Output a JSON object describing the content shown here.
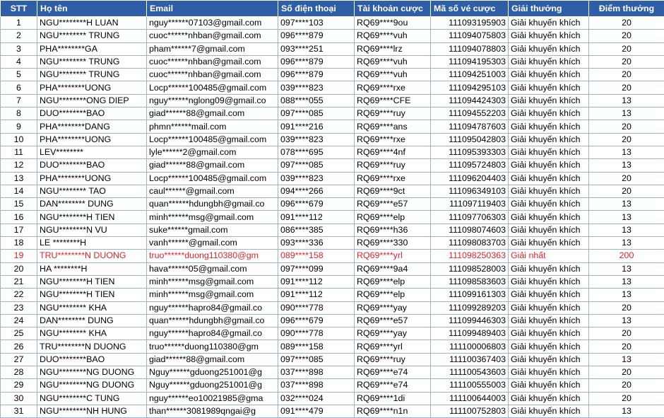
{
  "headers": {
    "stt": "STT",
    "ho_ten": "Họ tên",
    "email": "Email",
    "so_dien_thoai": "Số điện thoại",
    "tai_khoan_cuoc": "Tài khoản cược",
    "ma_so_ve_cuoc": "Mã số vé cược",
    "giai_thuong": "Giải thưởng",
    "diem_thuong": "Điểm thưởng"
  },
  "highlight_color": "#e8202a",
  "header_color": "#2f5ea8",
  "rows": [
    {
      "stt": "1",
      "ho_ten": "NGU********H LUAN",
      "email": "nguy******07103@gmail.com",
      "phone": "097****103",
      "account": "RQ69****9ou",
      "ticket": "111093195903",
      "prize": "Giải khuyến khích",
      "points": "20",
      "highlight": false
    },
    {
      "stt": "2",
      "ho_ten": "NGU******** TRUNG",
      "email": "cuoc******nhban@gmail.com",
      "phone": "096****879",
      "account": "RQ69****vuh",
      "ticket": "111094075803",
      "prize": "Giải khuyến khích",
      "points": "20",
      "highlight": false
    },
    {
      "stt": "3",
      "ho_ten": "PHA********GA",
      "email": "pham******7@gmail.com",
      "phone": "093****251",
      "account": "RQ69****lrz",
      "ticket": "111094078803",
      "prize": "Giải khuyến khích",
      "points": "20",
      "highlight": false
    },
    {
      "stt": "4",
      "ho_ten": "NGU******** TRUNG",
      "email": "cuoc******nhban@gmail.com",
      "phone": "096****879",
      "account": "RQ69****vuh",
      "ticket": "111094195303",
      "prize": "Giải khuyến khích",
      "points": "20",
      "highlight": false
    },
    {
      "stt": "5",
      "ho_ten": "NGU******** TRUNG",
      "email": "cuoc******nhban@gmail.com",
      "phone": "096****879",
      "account": "RQ69****vuh",
      "ticket": "111094251003",
      "prize": "Giải khuyến khích",
      "points": "20",
      "highlight": false
    },
    {
      "stt": "6",
      "ho_ten": "PHA********UONG",
      "email": "Locp******100485@gmail.com",
      "phone": "039****823",
      "account": "RQ69****rxe",
      "ticket": "111094295103",
      "prize": "Giải khuyến khích",
      "points": "20",
      "highlight": false
    },
    {
      "stt": "7",
      "ho_ten": "NGU********ONG DIEP",
      "email": "nguy******nglong09@gmail.co",
      "phone": "088****055",
      "account": "RQ69****CFE",
      "ticket": "111094424303",
      "prize": "Giải khuyến khích",
      "points": "13",
      "highlight": false
    },
    {
      "stt": "8",
      "ho_ten": "DUO********BAO",
      "email": "giad******88@gmail.com",
      "phone": "097****085",
      "account": "RQ69****ruy",
      "ticket": "111094552203",
      "prize": "Giải khuyến khích",
      "points": "13",
      "highlight": false
    },
    {
      "stt": "9",
      "ho_ten": "PHA********DANG",
      "email": "phmn******mail.com",
      "phone": "091****216",
      "account": "RQ69****ans",
      "ticket": "111094787603",
      "prize": "Giải khuyến khích",
      "points": "20",
      "highlight": false
    },
    {
      "stt": "10",
      "ho_ten": "PHA********UONG",
      "email": "Locp******100485@gmail.com",
      "phone": "039****823",
      "account": "RQ69****rxe",
      "ticket": "111095042803",
      "prize": "Giải khuyến khích",
      "points": "20",
      "highlight": false
    },
    {
      "stt": "11",
      "ho_ten": "LEV********",
      "email": "lyle******2@gmail.com",
      "phone": "078****695",
      "account": "RQ69****4nf",
      "ticket": "111095393303",
      "prize": "Giải khuyến khích",
      "points": "13",
      "highlight": false
    },
    {
      "stt": "12",
      "ho_ten": "DUO********BAO",
      "email": "giad******88@gmail.com",
      "phone": "097****085",
      "account": "RQ69****ruy",
      "ticket": "111095724803",
      "prize": "Giải khuyến khích",
      "points": "13",
      "highlight": false
    },
    {
      "stt": "13",
      "ho_ten": "PHA********UONG",
      "email": "Locp******100485@gmail.com",
      "phone": "039****823",
      "account": "RQ69****rxe",
      "ticket": "111096204403",
      "prize": "Giải khuyến khích",
      "points": "20",
      "highlight": false
    },
    {
      "stt": "14",
      "ho_ten": "NGU******** TAO",
      "email": "caul******@gmail.com",
      "phone": "094****266",
      "account": "RQ69****9ct",
      "ticket": "111096349103",
      "prize": "Giải khuyến khích",
      "points": "20",
      "highlight": false
    },
    {
      "stt": "15",
      "ho_ten": "DAN******** DUNG",
      "email": "quan******hdungbh@gmail.co",
      "phone": "096****679",
      "account": "RQ69****e57",
      "ticket": "111097119403",
      "prize": "Giải khuyến khích",
      "points": "13",
      "highlight": false
    },
    {
      "stt": "16",
      "ho_ten": "NGU********H TIEN",
      "email": "minh******msg@gmail.com",
      "phone": "091****112",
      "account": "RQ69****elp",
      "ticket": "111097706303",
      "prize": "Giải khuyến khích",
      "points": "13",
      "highlight": false
    },
    {
      "stt": "17",
      "ho_ten": "NGU********N VU",
      "email": "suke******gmail.com",
      "phone": "086****385",
      "account": "RQ69****h36",
      "ticket": "111098074603",
      "prize": "Giải khuyến khích",
      "points": "13",
      "highlight": false
    },
    {
      "stt": "18",
      "ho_ten": "LE ********H",
      "email": "vanh******@gmail.com",
      "phone": "093****336",
      "account": "RQ69****330",
      "ticket": "111098083703",
      "prize": "Giải khuyến khích",
      "points": "13",
      "highlight": false
    },
    {
      "stt": "19",
      "ho_ten": "TRU********N DUONG",
      "email": "truo******duong110380@gm",
      "phone": "089****158",
      "account": "RQ69****yrl",
      "ticket": "111098250363",
      "prize": "Giải nhất",
      "points": "200",
      "highlight": true
    },
    {
      "stt": "20",
      "ho_ten": "HA ********H",
      "email": "hava******05@gmail.com",
      "phone": "097****099",
      "account": "RQ69****9a4",
      "ticket": "111098528003",
      "prize": "Giải khuyến khích",
      "points": "13",
      "highlight": false
    },
    {
      "stt": "21",
      "ho_ten": "NGU********H TIEN",
      "email": "minh******msg@gmail.com",
      "phone": "091****112",
      "account": "RQ69****elp",
      "ticket": "111098583603",
      "prize": "Giải khuyến khích",
      "points": "13",
      "highlight": false
    },
    {
      "stt": "22",
      "ho_ten": "NGU********H TIEN",
      "email": "minh******msg@gmail.com",
      "phone": "091****112",
      "account": "RQ69****elp",
      "ticket": "111099161303",
      "prize": "Giải khuyến khích",
      "points": "13",
      "highlight": false
    },
    {
      "stt": "23",
      "ho_ten": "NGU******** KHA",
      "email": "nguy******hapro84@gmail.co",
      "phone": "090****778",
      "account": "RQ69****yay",
      "ticket": "111099289203",
      "prize": "Giải khuyến khích",
      "points": "20",
      "highlight": false
    },
    {
      "stt": "24",
      "ho_ten": "DAN******** DUNG",
      "email": "quan******hdungbh@gmail.co",
      "phone": "096****679",
      "account": "RQ69****e57",
      "ticket": "111099446303",
      "prize": "Giải khuyến khích",
      "points": "13",
      "highlight": false
    },
    {
      "stt": "25",
      "ho_ten": "NGU******** KHA",
      "email": "nguy******hapro84@gmail.co",
      "phone": "090****778",
      "account": "RQ69****yay",
      "ticket": "111099489403",
      "prize": "Giải khuyến khích",
      "points": "20",
      "highlight": false
    },
    {
      "stt": "26",
      "ho_ten": "TRU********N DUONG",
      "email": "truo******duong110380@gm",
      "phone": "089****158",
      "account": "RQ69****yrl",
      "ticket": "111100006803",
      "prize": "Giải khuyến khích",
      "points": "20",
      "highlight": false
    },
    {
      "stt": "27",
      "ho_ten": "DUO********BAO",
      "email": "giad******88@gmail.com",
      "phone": "097****085",
      "account": "RQ69****ruy",
      "ticket": "111100367403",
      "prize": "Giải khuyến khích",
      "points": "13",
      "highlight": false
    },
    {
      "stt": "28",
      "ho_ten": "NGU********NG DUONG",
      "email": "Nguy******gduong251001@g",
      "phone": "037****898",
      "account": "RQ69****e74",
      "ticket": "111100543603",
      "prize": "Giải khuyến khích",
      "points": "20",
      "highlight": false
    },
    {
      "stt": "29",
      "ho_ten": "NGU********NG DUONG",
      "email": "Nguy******gduong251001@g",
      "phone": "037****898",
      "account": "RQ69****e74",
      "ticket": "111100555003",
      "prize": "Giải khuyến khích",
      "points": "20",
      "highlight": false
    },
    {
      "stt": "30",
      "ho_ten": "NGU********C TUNG",
      "email": "nguy******eo10021985@gma",
      "phone": "032****024",
      "account": "RQ69****1di",
      "ticket": "111100644003",
      "prize": "Giải khuyến khích",
      "points": "20",
      "highlight": false
    },
    {
      "stt": "31",
      "ho_ten": "NGU********NH HUNG",
      "email": "than******3081989qngai@g",
      "phone": "091****479",
      "account": "RQ69****n1n",
      "ticket": "111100752803",
      "prize": "Giải khuyến khích",
      "points": "13",
      "highlight": false
    }
  ]
}
